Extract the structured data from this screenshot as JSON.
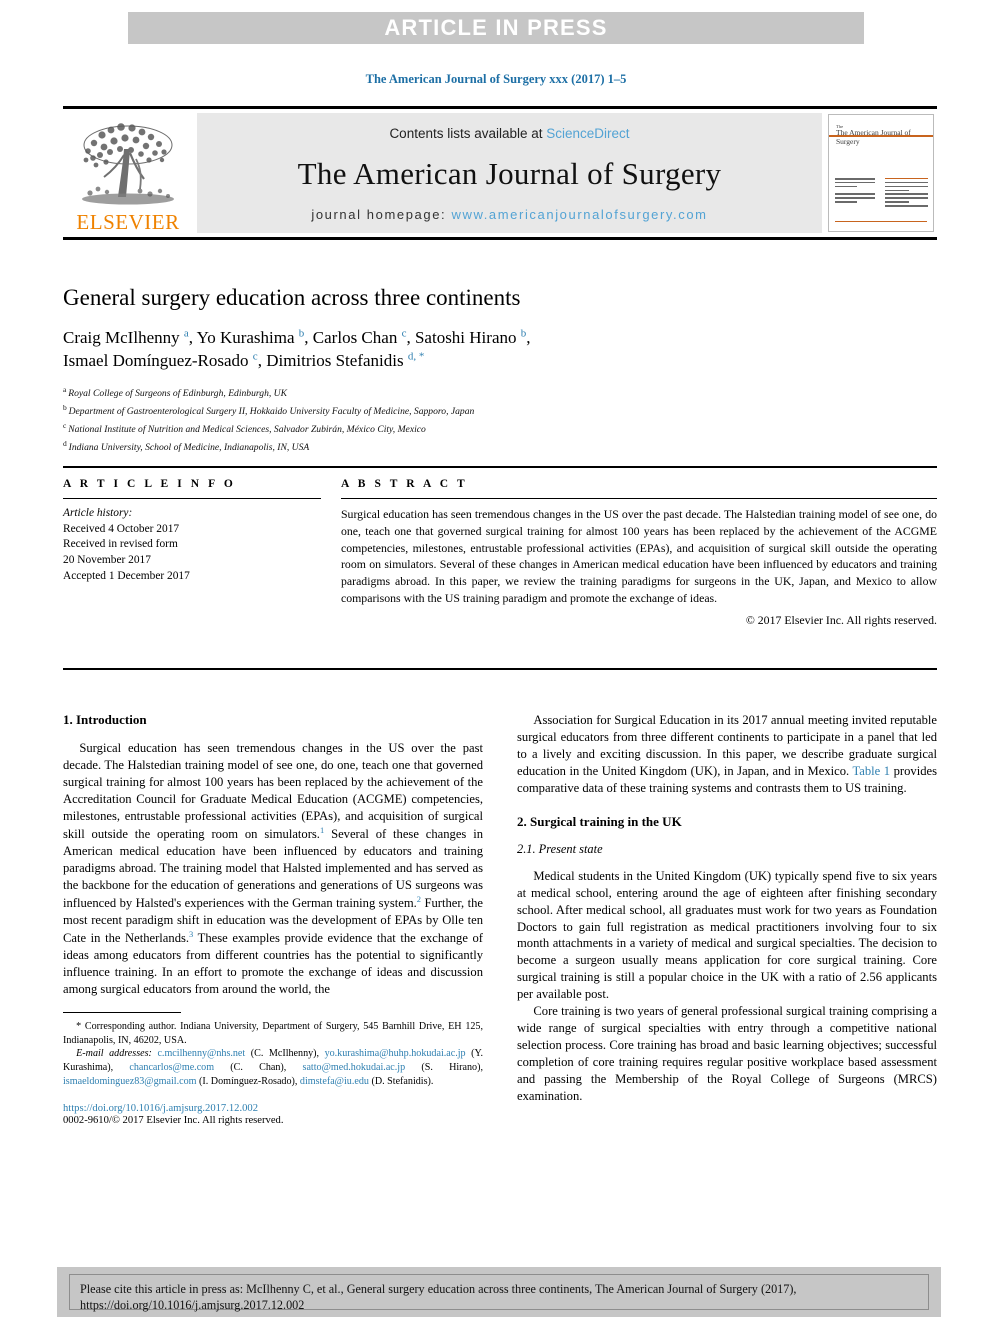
{
  "banner": {
    "text": "ARTICLE IN PRESS"
  },
  "running_head": "The American Journal of Surgery xxx (2017) 1–5",
  "masthead": {
    "publisher": "ELSEVIER",
    "contents_prefix": "Contents lists available at ",
    "contents_link": "ScienceDirect",
    "journal_title": "The American Journal of Surgery",
    "homepage_label": "journal homepage: ",
    "homepage_url": "www.americanjournalofsurgery.com",
    "cover_title": "The American Journal of Surgery",
    "cover_title_small": "The"
  },
  "article": {
    "title": "General surgery education across three continents",
    "authors": [
      {
        "name": "Craig McIlhenny",
        "sup": "a",
        "sep": ", "
      },
      {
        "name": "Yo Kurashima",
        "sup": "b",
        "sep": ", "
      },
      {
        "name": "Carlos Chan",
        "sup": "c",
        "sep": ", "
      },
      {
        "name": "Satoshi Hirano",
        "sup": "b",
        "sep": ","
      },
      {
        "name": "Ismael Domínguez-Rosado",
        "sup": "c",
        "sep": ", "
      },
      {
        "name": "Dimitrios Stefanidis",
        "sup": "d, *",
        "sep": ""
      }
    ],
    "affiliations": [
      {
        "marker": "a",
        "text": "Royal College of Surgeons of Edinburgh, Edinburgh, UK"
      },
      {
        "marker": "b",
        "text": "Department of Gastroenterological Surgery II, Hokkaido University Faculty of Medicine, Sapporo, Japan"
      },
      {
        "marker": "c",
        "text": "National Institute of Nutrition and Medical Sciences, Salvador Zubirán, México City, Mexico"
      },
      {
        "marker": "d",
        "text": "Indiana University, School of Medicine, Indianapolis, IN, USA"
      }
    ]
  },
  "article_info": {
    "heading": "A R T I C L E  I N F O",
    "history_label": "Article history:",
    "history": [
      "Received 4 October 2017",
      "Received in revised form",
      "20 November 2017",
      "Accepted 1 December 2017"
    ]
  },
  "abstract": {
    "heading": "A B S T R A C T",
    "text": "Surgical education has seen tremendous changes in the US over the past decade. The Halstedian training model of see one, do one, teach one that governed surgical training for almost 100 years has been replaced by the achievement of the ACGME competencies, milestones, entrustable professional activities (EPAs), and acquisition of surgical skill outside the operating room on simulators. Several of these changes in American medical education have been influenced by educators and training paradigms abroad. In this paper, we review the training paradigms for surgeons in the UK, Japan, and Mexico to allow comparisons with the US training paradigm and promote the exchange of ideas.",
    "copyright": "© 2017 Elsevier Inc. All rights reserved."
  },
  "body": {
    "left": {
      "heading": "1. Introduction",
      "para1_a": "Surgical education has seen tremendous changes in the US over the past decade. The Halstedian training model of see one, do one, teach one that governed surgical training for almost 100 years has been replaced by the achievement of the Accreditation Council for Graduate Medical Education (ACGME) competencies, milestones, entrustable professional activities (EPAs), and acquisition of surgical skill outside the operating room on simulators.",
      "ref1": "1",
      "para1_b": " Several of these changes in American medical education have been influenced by educators and training paradigms abroad. The training model that Halsted implemented and has served as the backbone for the education of generations and generations of US surgeons was influenced by Halsted's experiences with the German training system.",
      "ref2": "2",
      "para1_c": " Further, the most recent paradigm shift in education was the development of EPAs by Olle ten Cate in the Netherlands.",
      "ref3": "3",
      "para1_d": " These examples provide evidence that the exchange of ideas among educators from different countries has the potential to significantly influence training. In an effort to promote the exchange of ideas and discussion among surgical educators from around the world, the"
    },
    "right": {
      "para_cont_a": "Association for Surgical Education in its 2017 annual meeting invited reputable surgical educators from three different continents to participate in a panel that led to a lively and exciting discussion. In this paper, we describe graduate surgical education in the United Kingdom (UK), in Japan, and in Mexico. ",
      "table_link": "Table 1",
      "para_cont_b": " provides comparative data of these training systems and contrasts them to US training.",
      "heading2": "2. Surgical training in the UK",
      "subheading": "2.1. Present state",
      "para2": "Medical students in the United Kingdom (UK) typically spend five to six years at medical school, entering around the age of eighteen after finishing secondary school. After medical school, all graduates must work for two years as Foundation Doctors to gain full registration as medical practitioners involving four to six month attachments in a variety of medical and surgical specialties. The decision to become a surgeon usually means application for core surgical training. Core surgical training is still a popular choice in the UK with a ratio of 2.56 applicants per available post.",
      "para3": "Core training is two years of general professional surgical training comprising a wide range of surgical specialties with entry through a competitive national selection process. Core training has broad and basic learning objectives; successful completion of core training requires regular positive workplace based assessment and passing the Membership of the Royal College of Surgeons (MRCS) examination."
    }
  },
  "footnote": {
    "star": "*",
    "corresponding": " Corresponding author. Indiana University, Department of Surgery, 545 Barnhill Drive, EH 125, Indianapolis, IN, 46202, USA.",
    "email_label": "E-mail addresses:",
    "emails": [
      {
        "address": "c.mcilhenny@nhs.net",
        "who": " (C. McIlhenny), "
      },
      {
        "address": "yo.kurashima@huhp.hokudai.ac.jp",
        "who": " (Y. Kurashima), "
      },
      {
        "address": "chancarlos@me.com",
        "who": " (C. Chan), "
      },
      {
        "address": "satto@med.hokudai.ac.jp",
        "who": " (S. Hirano), "
      },
      {
        "address": "ismaeldominguez83@gmail.com",
        "who": " (I. Domínguez-Rosado), "
      },
      {
        "address": "dimstefa@iu.edu",
        "who": " (D. Stefanidis)."
      }
    ],
    "doi": "https://doi.org/10.1016/j.amjsurg.2017.12.002",
    "issn": "0002-9610/© 2017 Elsevier Inc. All rights reserved."
  },
  "cite_box": {
    "line1": "Please cite this article in press as: McIlhenny C, et al., General surgery education across three continents, The American Journal of Surgery (2017),",
    "line2": "https://doi.org/10.1016/j.amjsurg.2017.12.002"
  },
  "colors": {
    "link_blue": "#2e7fb0",
    "light_blue": "#53a3d4",
    "elsevier_orange": "#ef8200",
    "banner_gray": "#c6c6c6"
  }
}
